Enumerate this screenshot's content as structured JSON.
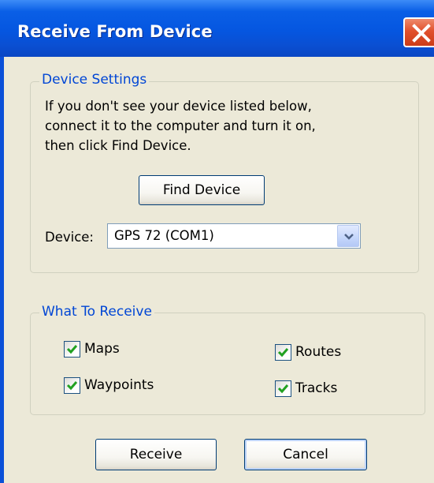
{
  "window": {
    "title": "Receive From Device"
  },
  "device_settings": {
    "legend": "Device Settings",
    "instructions": [
      "If you don't see your device listed below,",
      "connect it to the computer and turn it on,",
      "then click Find Device."
    ],
    "find_device_label": "Find Device",
    "device_label": "Device:",
    "device_value": "GPS 72 (COM1)"
  },
  "what_to_receive": {
    "legend": "What To Receive",
    "options": {
      "maps": {
        "label": "Maps",
        "checked": true
      },
      "routes": {
        "label": "Routes",
        "checked": true
      },
      "waypoints": {
        "label": "Waypoints",
        "checked": true
      },
      "tracks": {
        "label": "Tracks",
        "checked": true
      }
    }
  },
  "footer": {
    "receive_label": "Receive",
    "cancel_label": "Cancel"
  },
  "colors": {
    "titlebar": "#0556e0",
    "dialog_bg": "#ece9d8",
    "group_label": "#0046d5",
    "checkmark": "#21a121",
    "close_button": "#e1502c"
  },
  "icons": {
    "close": "close-icon",
    "dropdown": "chevron-down-icon",
    "check": "check-icon"
  }
}
